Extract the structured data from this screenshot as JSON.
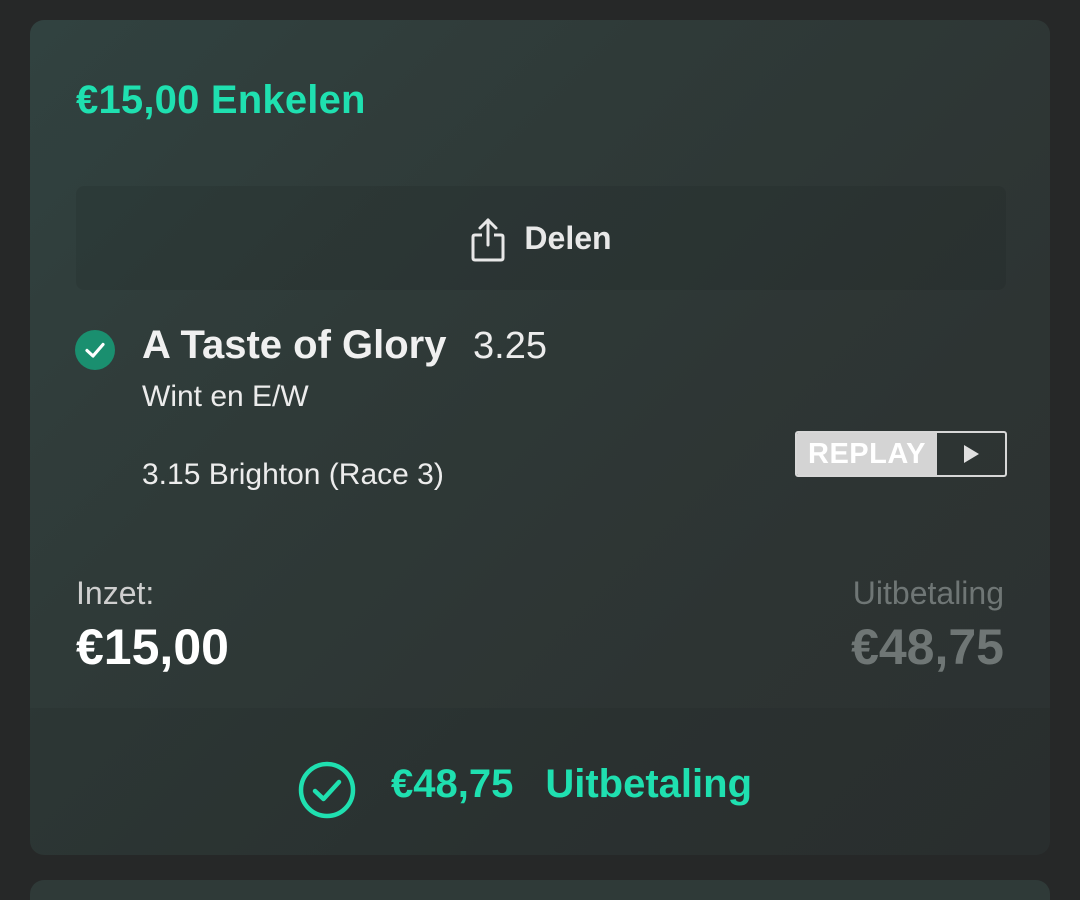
{
  "bet": {
    "title": "€15,00 Enkelen"
  },
  "share": {
    "label": "Delen",
    "icon": "share-icon"
  },
  "selection": {
    "status_icon": "check-circle-icon",
    "name": "A Taste of Glory",
    "odds": "3.25",
    "market": "Wint en E/W",
    "event": "3.15 Brighton (Race 3)"
  },
  "replay": {
    "label": "REPLAY",
    "icon": "play-icon"
  },
  "stake": {
    "label": "Inzet:",
    "value": "€15,00"
  },
  "payout": {
    "label": "Uitbetaling",
    "value": "€48,75"
  },
  "footer": {
    "icon": "check-circle-outline-icon",
    "amount": "€48,75",
    "text": "Uitbetaling"
  },
  "colors": {
    "accent": "#1fe0b0",
    "check_fill": "#1a8f6f",
    "muted": "#6f7675",
    "background": "#262828"
  }
}
